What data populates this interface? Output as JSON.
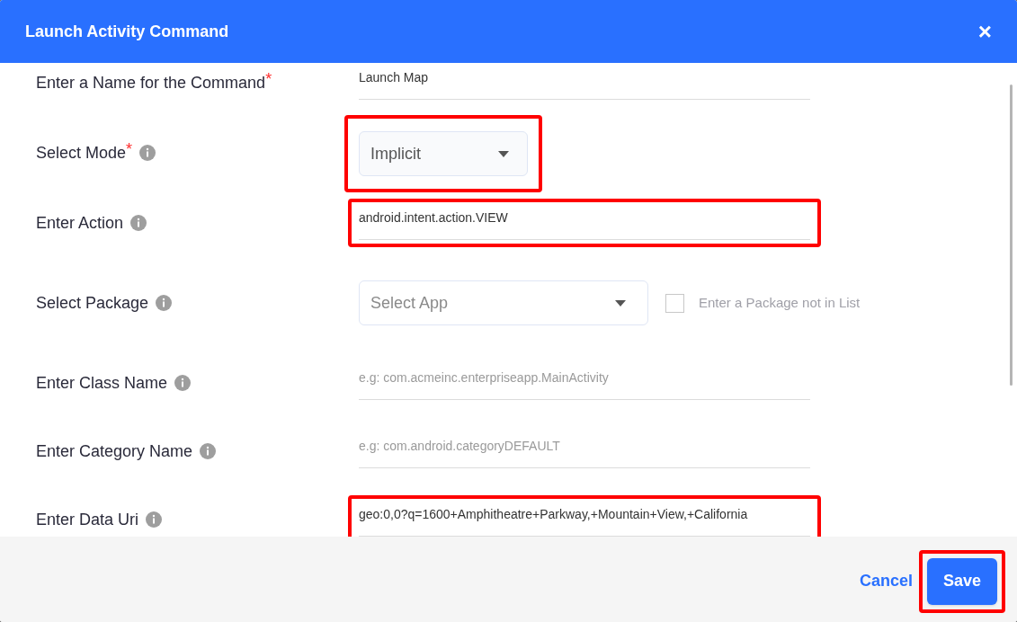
{
  "dialog": {
    "title": "Launch Activity Command",
    "close_glyph": "×"
  },
  "fields": [
    {
      "kind": "text",
      "label": "Enter a Name for the Command",
      "required_mark": "*",
      "info": false,
      "value": "Launch Map",
      "highlighted": false
    },
    {
      "kind": "select",
      "label": "Select Mode",
      "required_mark": "*",
      "info": true,
      "value": "Implicit",
      "highlighted": true
    },
    {
      "kind": "text",
      "label": "Enter Action",
      "info": true,
      "value": "android.intent.action.VIEW",
      "highlighted": true
    },
    {
      "kind": "package",
      "label": "Select Package",
      "info": true,
      "placeholder": "Select App",
      "checkbox": {
        "label": "Enter a Package not in List",
        "checked": false
      },
      "highlighted": false
    },
    {
      "kind": "text",
      "label": "Enter Class Name",
      "info": true,
      "placeholder": "e.g: com.acmeinc.enterpriseapp.MainActivity",
      "highlighted": false
    },
    {
      "kind": "text",
      "label": "Enter Category Name",
      "info": true,
      "placeholder": "e.g: com.android.categoryDEFAULT",
      "highlighted": false
    },
    {
      "kind": "text",
      "label": "Enter Data Uri",
      "info": true,
      "value": "geo:0,0?q=1600+Amphitheatre+Parkway,+Mountain+View,+California",
      "highlighted": true
    }
  ],
  "footer": {
    "cancel": "Cancel",
    "save": {
      "label": "Save",
      "highlighted": true
    }
  }
}
